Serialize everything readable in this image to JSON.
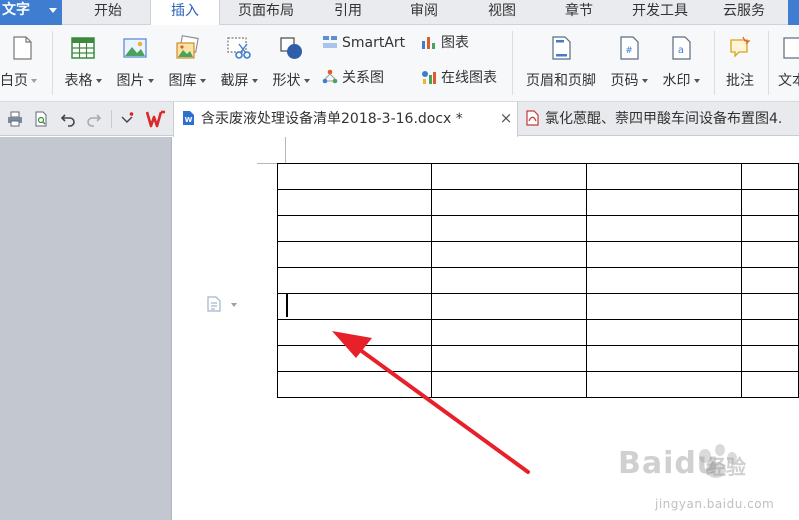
{
  "app": {
    "name": "文字"
  },
  "menu": {
    "tabs": [
      {
        "label": "开始",
        "active": false
      },
      {
        "label": "插入",
        "active": true
      },
      {
        "label": "页面布局",
        "active": false
      },
      {
        "label": "引用",
        "active": false
      },
      {
        "label": "审阅",
        "active": false
      },
      {
        "label": "视图",
        "active": false
      },
      {
        "label": "章节",
        "active": false
      },
      {
        "label": "开发工具",
        "active": false
      },
      {
        "label": "云服务",
        "active": false
      }
    ]
  },
  "ribbon": {
    "blank_page": "白页",
    "table": "表格",
    "picture": "图片",
    "gallery": "图库",
    "screenshot": "截屏",
    "shapes": "形状",
    "smartart": "SmartArt",
    "chart": "图表",
    "relation": "关系图",
    "online_chart": "在线图表",
    "header_footer": "页眉和页脚",
    "page_number": "页码",
    "watermark": "水印",
    "comment": "批注",
    "textbox": "文本"
  },
  "tabs": {
    "active": {
      "title": "含汞废液处理设备清单2018-3-16.docx *"
    },
    "other": {
      "title": "氯化蒽醌、萘四甲酸车间设备布置图4."
    }
  },
  "document": {
    "table": {
      "rows": 9,
      "cols": 4
    }
  },
  "watermark": {
    "brand": "Baidu",
    "suffix": "经验",
    "url": "jingyan.baidu.com"
  },
  "colors": {
    "accent": "#3f7dd1",
    "arrow": "#e8202a",
    "active_tab_text": "#2b62b5"
  }
}
